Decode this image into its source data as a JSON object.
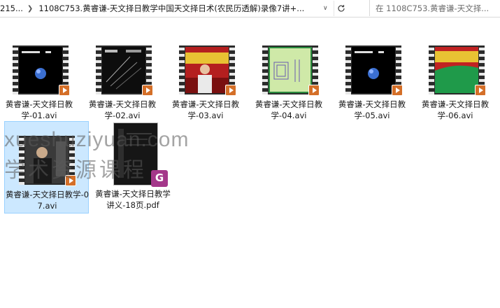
{
  "address": {
    "prev_crumb": "215...",
    "path": "1108C753.黄睿谦-天文择日教学中国天文择日术(农民历透解)录像7讲+..."
  },
  "search": {
    "placeholder": "在 1108C753.黄睿谦-天文择..."
  },
  "files": [
    {
      "name": "黄睿谦-天文择日教学-01.avi",
      "thumb": "earth",
      "selected": false
    },
    {
      "name": "黄睿谦-天文择日教学-02.avi",
      "thumb": "dark-lines",
      "selected": false
    },
    {
      "name": "黄睿谦-天文择日教学-03.avi",
      "thumb": "presenter-red",
      "selected": false
    },
    {
      "name": "黄睿谦-天文择日教学-04.avi",
      "thumb": "green-board",
      "selected": false
    },
    {
      "name": "黄睿谦-天文择日教学-05.avi",
      "thumb": "earth",
      "selected": false
    },
    {
      "name": "黄睿谦-天文择日教学-06.avi",
      "thumb": "green-red",
      "selected": false
    },
    {
      "name": "黄睿谦-天文择日教学-07.avi",
      "thumb": "presenter-dark",
      "selected": true
    },
    {
      "name": "黄睿谦-天文择日教学讲义-18页.pdf",
      "thumb": "pdf",
      "selected": false
    }
  ],
  "watermark": {
    "line1": "xueshuziyuan.com",
    "line2": "学术资源课程"
  },
  "colors": {
    "selection": "#cce8ff",
    "selection_border": "#99d1ff",
    "play_badge": "#d46f28",
    "pdf_badge": "#a4378a"
  }
}
